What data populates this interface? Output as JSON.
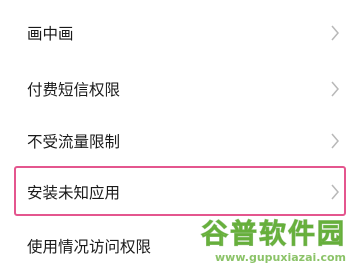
{
  "settings_list": {
    "items": [
      {
        "label": "画中画",
        "icon": "chevron-right-icon"
      },
      {
        "label": "付费短信权限",
        "icon": "chevron-right-icon"
      },
      {
        "label": "不受流量限制",
        "icon": "chevron-right-icon"
      },
      {
        "label": "安装未知应用",
        "icon": "chevron-right-icon",
        "highlighted": true
      },
      {
        "label": "使用情况访问权限"
      }
    ]
  },
  "watermark": {
    "logo_text": "谷普软件园",
    "url": "www.gupuxiazai.com"
  },
  "colors": {
    "highlight_border": "#e4568e",
    "text": "#1a1a1a",
    "chevron": "#b8b8b8",
    "watermark": "#78c83c"
  }
}
